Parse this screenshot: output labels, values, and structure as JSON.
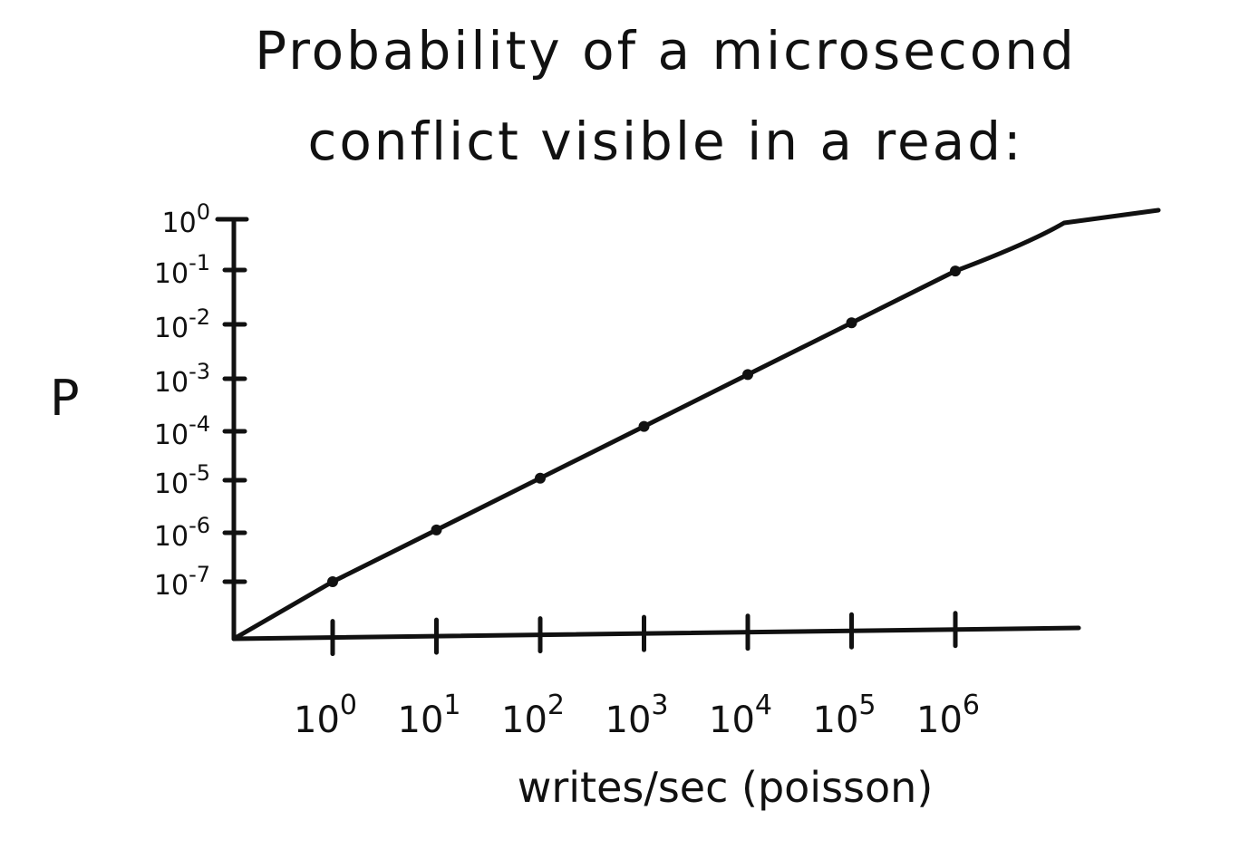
{
  "chart_data": {
    "type": "line",
    "title_line1": "Probability of a microsecond",
    "title_line2": "conflict visible in a read:",
    "ylabel": "P",
    "xlabel": "writes/sec (poisson)",
    "scale": "log-log",
    "grid": false,
    "legend": "none",
    "x_ticks": [
      {
        "base": "10",
        "exp": "0"
      },
      {
        "base": "10",
        "exp": "1"
      },
      {
        "base": "10",
        "exp": "2"
      },
      {
        "base": "10",
        "exp": "3"
      },
      {
        "base": "10",
        "exp": "4"
      },
      {
        "base": "10",
        "exp": "5"
      },
      {
        "base": "10",
        "exp": "6"
      }
    ],
    "y_ticks": [
      {
        "base": "10",
        "exp": "0"
      },
      {
        "base": "10",
        "exp": "-1"
      },
      {
        "base": "10",
        "exp": "-2"
      },
      {
        "base": "10",
        "exp": "-3"
      },
      {
        "base": "10",
        "exp": "-4"
      },
      {
        "base": "10",
        "exp": "-5"
      },
      {
        "base": "10",
        "exp": "-6"
      },
      {
        "base": "10",
        "exp": "-7"
      }
    ],
    "x": [
      1,
      10,
      100,
      1000,
      10000,
      100000,
      1000000
    ],
    "y": [
      1e-07,
      1e-06,
      1e-05,
      0.0001,
      0.001,
      0.01,
      0.1
    ],
    "saturation": 1,
    "line_color": "#111111"
  }
}
